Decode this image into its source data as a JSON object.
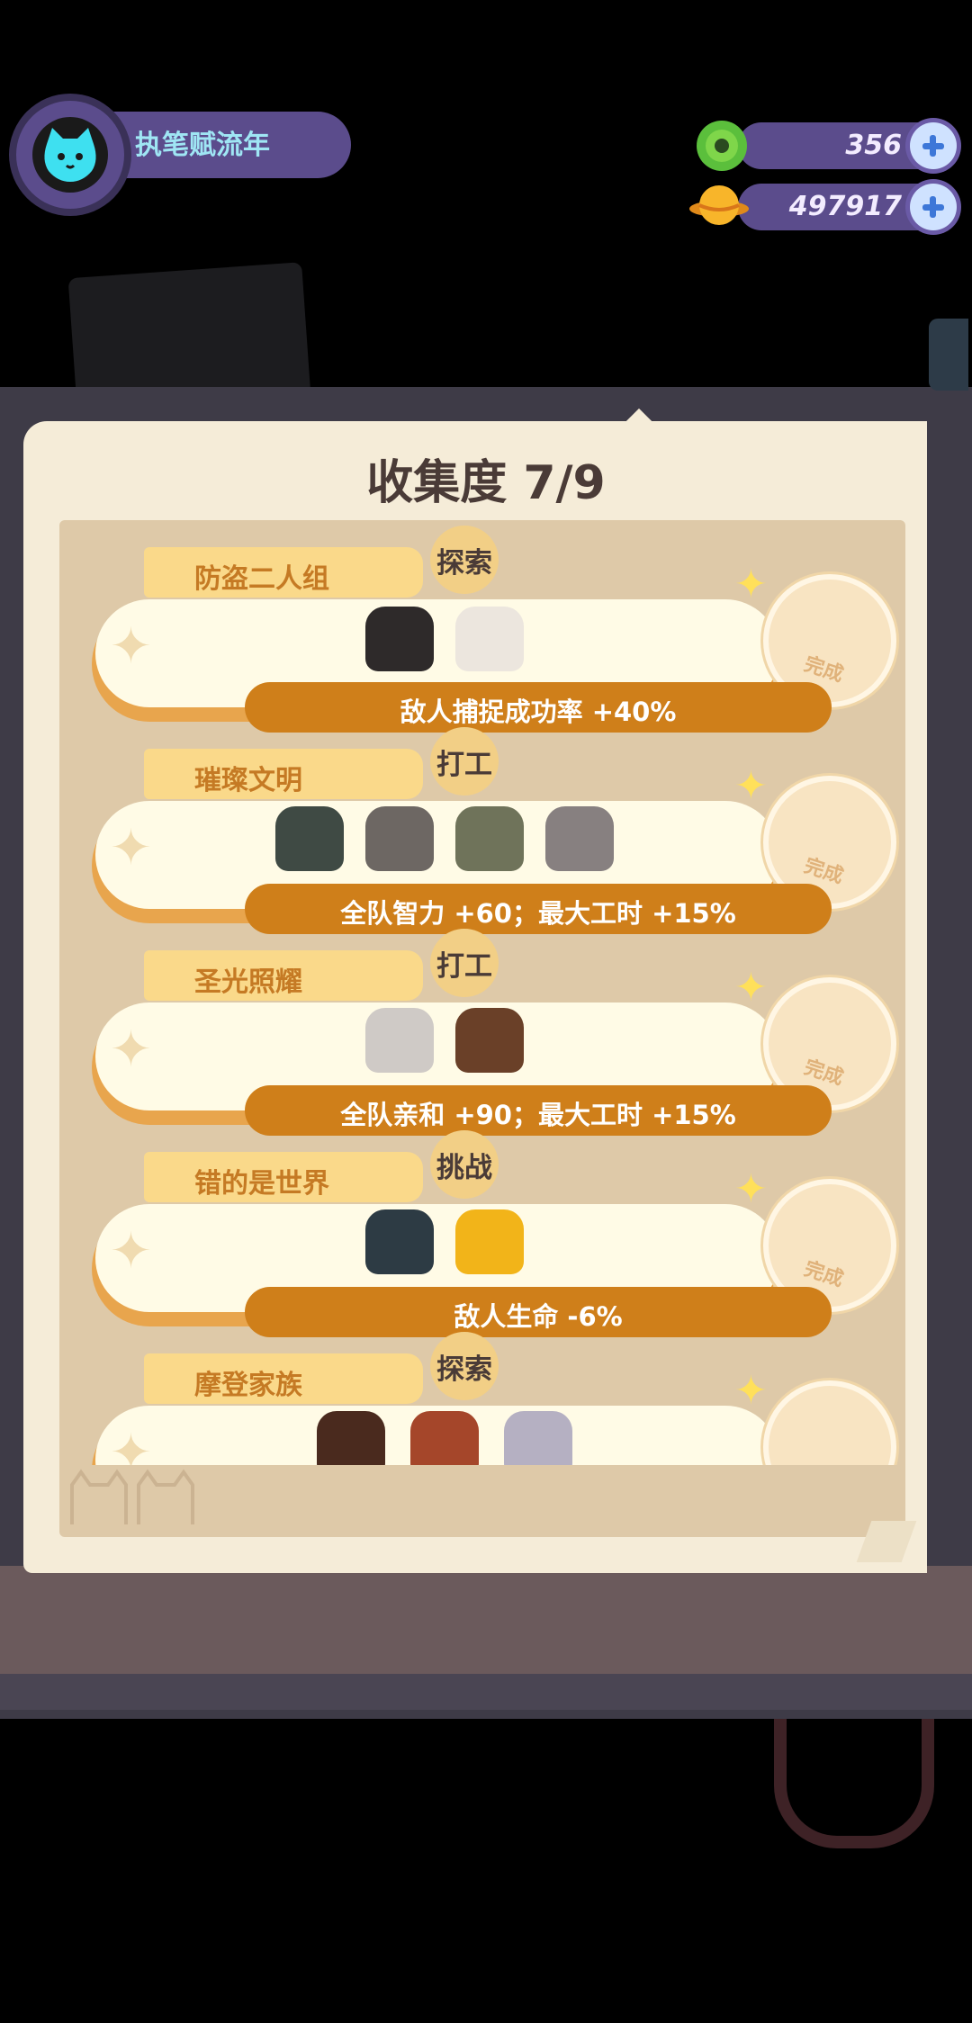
{
  "header": {
    "player_name": "执笔赋流年",
    "currencies": [
      {
        "icon": "gem-donut-icon",
        "value": "356"
      },
      {
        "icon": "coin-planet-icon",
        "value": "497917"
      }
    ]
  },
  "book": {
    "title": "收集度 7/9",
    "sets": [
      {
        "name": "防盗二人组",
        "type": "探索",
        "bonus": "敌人捕捉成功率 +40%",
        "status": "完成"
      },
      {
        "name": "璀璨文明",
        "type": "打工",
        "bonus": "全队智力 +60；最大工时 +15%",
        "status": "完成"
      },
      {
        "name": "圣光照耀",
        "type": "打工",
        "bonus": "全队亲和 +90；最大工时 +15%",
        "status": "完成"
      },
      {
        "name": "错的是世界",
        "type": "挑战",
        "bonus": "敌人生命 -6%",
        "status": "完成"
      },
      {
        "name": "摩登家族",
        "type": "探索",
        "bonus": "",
        "status": ""
      }
    ]
  },
  "colors": {
    "accent": "#cf7f1a",
    "hud_pill": "#5b4c8c",
    "page": "#f5ecd8"
  }
}
